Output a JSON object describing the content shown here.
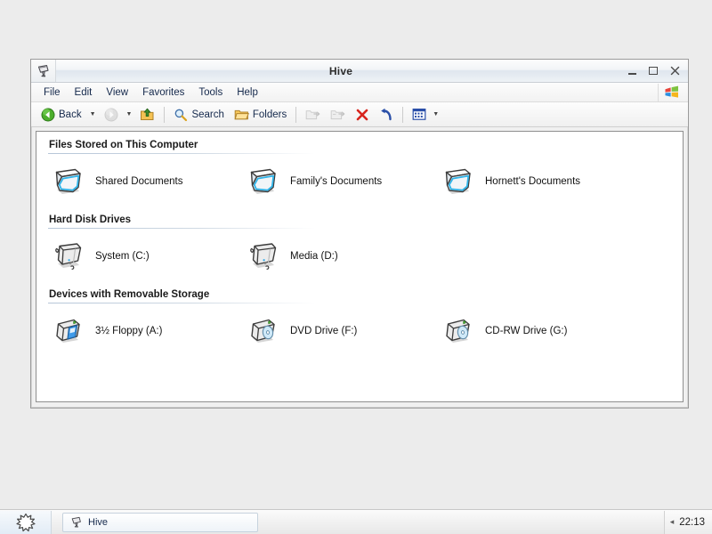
{
  "desktop": {
    "background_color": "#ececec"
  },
  "window": {
    "title": "Hive",
    "title_icon": "computer-icon",
    "controls": {
      "minimize_label": "Minimize",
      "maximize_label": "Maximize",
      "close_label": "Close"
    },
    "menu": [
      {
        "label": "File"
      },
      {
        "label": "Edit"
      },
      {
        "label": "View"
      },
      {
        "label": "Favorites"
      },
      {
        "label": "Tools"
      },
      {
        "label": "Help"
      }
    ],
    "menu_logo": "windows-flag-icon",
    "toolbar": {
      "back_label": "Back",
      "back_icon": "back-arrow-icon",
      "forward_icon": "forward-arrow-icon",
      "up_icon": "up-folder-icon",
      "search_label": "Search",
      "search_icon": "magnifier-icon",
      "folders_label": "Folders",
      "folders_icon": "folder-icon",
      "move_to_icon": "move-to-folder-icon",
      "copy_to_icon": "copy-to-folder-icon",
      "delete_icon": "delete-x-icon",
      "undo_icon": "undo-arrow-icon",
      "views_icon": "views-icon",
      "dropdown_caret": "▼"
    }
  },
  "groups": [
    {
      "header": "Files Stored on This Computer",
      "items": [
        {
          "label": "Shared Documents",
          "icon": "shared-documents-folder-icon"
        },
        {
          "label": "Family's Documents",
          "icon": "user-documents-folder-icon"
        },
        {
          "label": "Hornett's Documents",
          "icon": "user-documents-folder-icon"
        }
      ]
    },
    {
      "header": "Hard Disk Drives",
      "items": [
        {
          "label": "System (C:)",
          "icon": "hard-drive-icon"
        },
        {
          "label": "Media (D:)",
          "icon": "hard-drive-icon"
        }
      ]
    },
    {
      "header": "Devices with Removable Storage",
      "items": [
        {
          "label": "3½ Floppy (A:)",
          "icon": "floppy-drive-icon"
        },
        {
          "label": "DVD Drive (F:)",
          "icon": "optical-drive-icon"
        },
        {
          "label": "CD-RW Drive (G:)",
          "icon": "optical-drive-icon"
        }
      ]
    }
  ],
  "taskbar": {
    "start_icon": "start-starburst-icon",
    "tasks": [
      {
        "label": "Hive",
        "icon": "computer-icon"
      }
    ],
    "tray_arrow": "◂",
    "clock": "22:13"
  }
}
